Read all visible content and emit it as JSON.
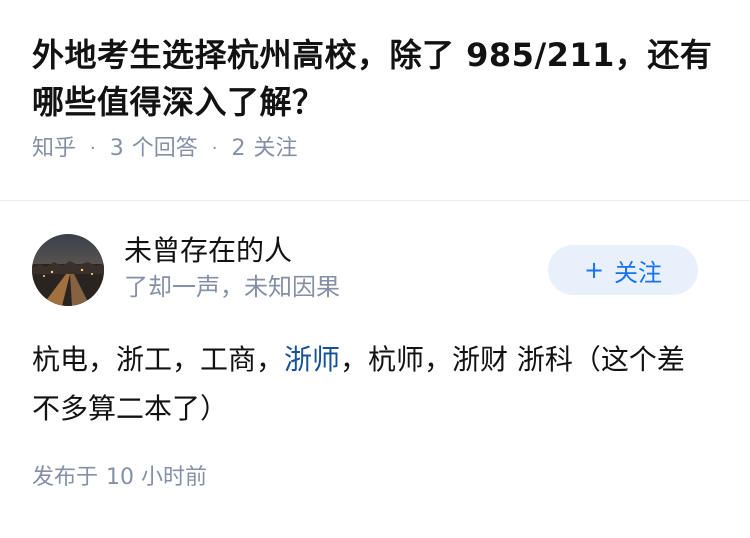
{
  "question": {
    "title": "外地考生选择杭州高校，除了 985/211，还有哪些值得深入了解？",
    "source": "知乎",
    "answer_count": "3",
    "answer_label": "个回答",
    "follow_count": "2",
    "follow_label": "关注",
    "separator": "·"
  },
  "answer": {
    "author": {
      "name": "未曾存在的人",
      "bio": "了却一声，未知因果"
    },
    "follow_button": {
      "icon": "+",
      "label": "关注"
    },
    "content": {
      "part1": "杭电，浙工，工商，",
      "link": "浙师",
      "part2": "，杭师，浙财 浙科（这个差不多算二本了）"
    },
    "published": {
      "label": "发布于",
      "time": "10 小时前"
    }
  },
  "colors": {
    "meta_gray": "#8590a6",
    "link_blue": "#175199",
    "button_blue": "#1772f6",
    "button_bg": "#e8f1fb"
  }
}
